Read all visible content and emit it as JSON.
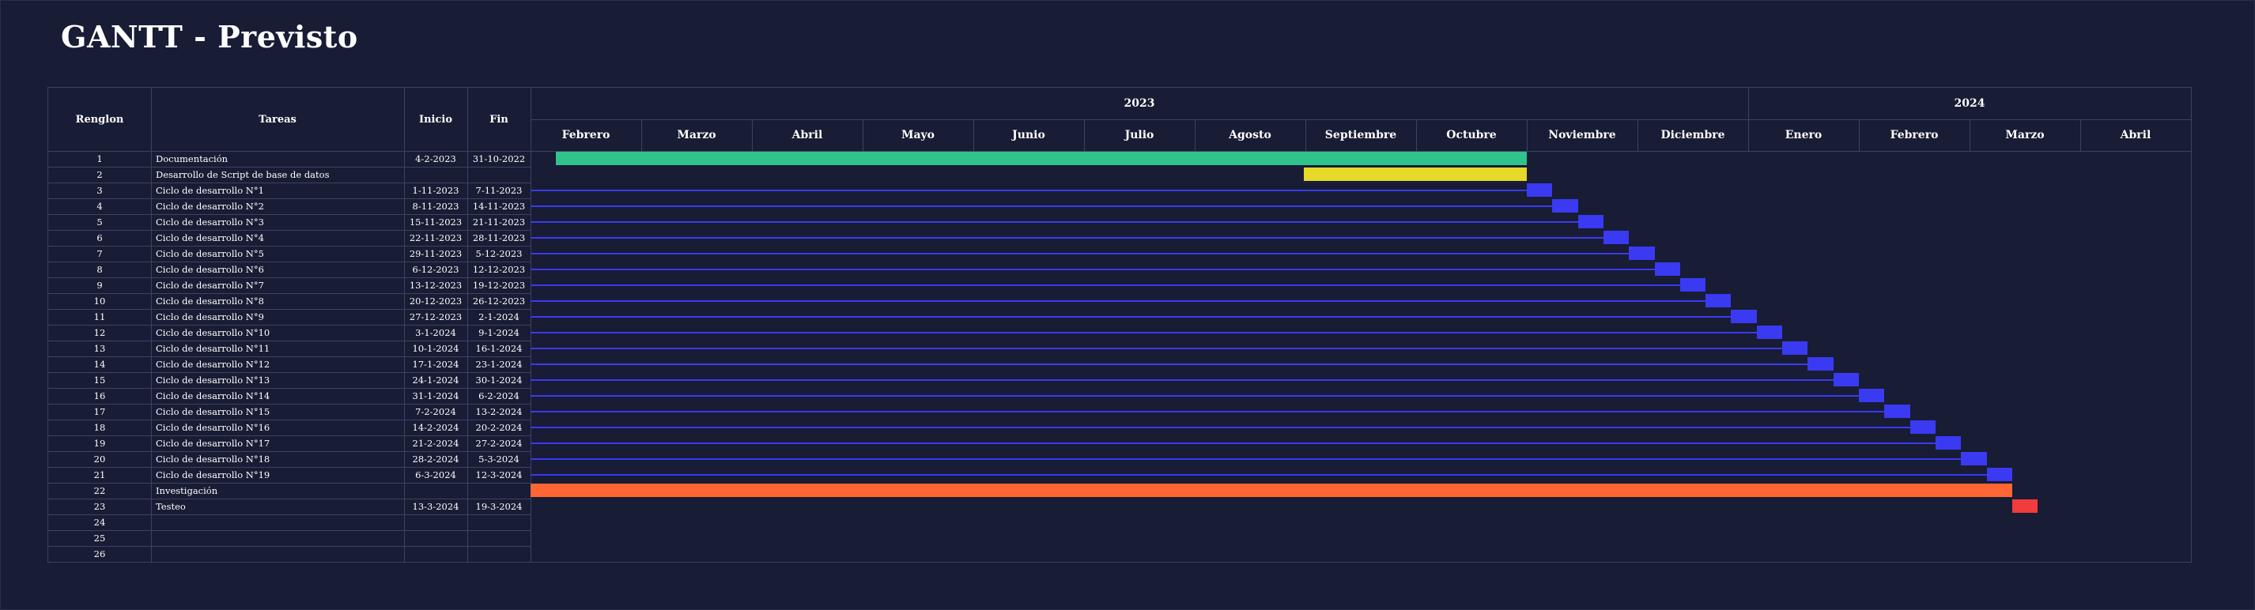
{
  "page": {
    "title": "GANTT - Previsto"
  },
  "table": {
    "headers": {
      "renglon": "Renglon",
      "tareas": "Tareas",
      "inicio": "Inicio",
      "fin": "Fin"
    },
    "rows": [
      {
        "n": "1",
        "task": "Documentación",
        "start": "4-2-2023",
        "end": "31-10-2022"
      },
      {
        "n": "2",
        "task": "Desarrollo de Script de base de datos",
        "start": "",
        "end": ""
      },
      {
        "n": "3",
        "task": "Ciclo de desarrollo N°1",
        "start": "1-11-2023",
        "end": "7-11-2023"
      },
      {
        "n": "4",
        "task": "Ciclo de desarrollo N°2",
        "start": "8-11-2023",
        "end": "14-11-2023"
      },
      {
        "n": "5",
        "task": "Ciclo de desarrollo N°3",
        "start": "15-11-2023",
        "end": "21-11-2023"
      },
      {
        "n": "6",
        "task": "Ciclo de desarrollo N°4",
        "start": "22-11-2023",
        "end": "28-11-2023"
      },
      {
        "n": "7",
        "task": "Ciclo de desarrollo N°5",
        "start": "29-11-2023",
        "end": "5-12-2023"
      },
      {
        "n": "8",
        "task": "Ciclo de desarrollo N°6",
        "start": "6-12-2023",
        "end": "12-12-2023"
      },
      {
        "n": "9",
        "task": "Ciclo de desarrollo N°7",
        "start": "13-12-2023",
        "end": "19-12-2023"
      },
      {
        "n": "10",
        "task": "Ciclo de desarrollo N°8",
        "start": "20-12-2023",
        "end": "26-12-2023"
      },
      {
        "n": "11",
        "task": "Ciclo de desarrollo N°9",
        "start": "27-12-2023",
        "end": "2-1-2024"
      },
      {
        "n": "12",
        "task": "Ciclo de desarrollo N°10",
        "start": "3-1-2024",
        "end": "9-1-2024"
      },
      {
        "n": "13",
        "task": "Ciclo de desarrollo N°11",
        "start": "10-1-2024",
        "end": "16-1-2024"
      },
      {
        "n": "14",
        "task": "Ciclo de desarrollo N°12",
        "start": "17-1-2024",
        "end": "23-1-2024"
      },
      {
        "n": "15",
        "task": "Ciclo de desarrollo N°13",
        "start": "24-1-2024",
        "end": "30-1-2024"
      },
      {
        "n": "16",
        "task": "Ciclo de desarrollo N°14",
        "start": "31-1-2024",
        "end": "6-2-2024"
      },
      {
        "n": "17",
        "task": "Ciclo de desarrollo N°15",
        "start": "7-2-2024",
        "end": "13-2-2024"
      },
      {
        "n": "18",
        "task": "Ciclo de desarrollo N°16",
        "start": "14-2-2024",
        "end": "20-2-2024"
      },
      {
        "n": "19",
        "task": "Ciclo de desarrollo N°17",
        "start": "21-2-2024",
        "end": "27-2-2024"
      },
      {
        "n": "20",
        "task": "Ciclo de desarrollo N°18",
        "start": "28-2-2024",
        "end": "5-3-2024"
      },
      {
        "n": "21",
        "task": "Ciclo de desarrollo N°19",
        "start": "6-3-2024",
        "end": "12-3-2024"
      },
      {
        "n": "22",
        "task": "Investigación",
        "start": "",
        "end": ""
      },
      {
        "n": "23",
        "task": "Testeo",
        "start": "13-3-2024",
        "end": "19-3-2024"
      },
      {
        "n": "24",
        "task": "",
        "start": "",
        "end": ""
      },
      {
        "n": "25",
        "task": "",
        "start": "",
        "end": ""
      },
      {
        "n": "26",
        "task": "",
        "start": "",
        "end": ""
      }
    ]
  },
  "timeline": {
    "years": [
      {
        "label": "2023",
        "months": 11
      },
      {
        "label": "2024",
        "months": 4
      }
    ],
    "months": [
      "Febrero",
      "Marzo",
      "Abril",
      "Mayo",
      "Junio",
      "Julio",
      "Agosto",
      "Septiembre",
      "Octubre",
      "Noviembre",
      "Diciembre",
      "Enero",
      "Febrero",
      "Marzo",
      "Abril"
    ],
    "range_start": "2023-02-01",
    "range_end": "2024-05-01"
  },
  "bars": [
    {
      "row": 1,
      "start": "2023-02-08",
      "end": "2023-11-01",
      "color": "#2ec48c"
    },
    {
      "row": 2,
      "start": "2023-09-01",
      "end": "2023-11-01",
      "color": "#e6d92a"
    },
    {
      "row": 3,
      "start": "2023-11-01",
      "end": "2023-11-08",
      "color": "#3a3af2",
      "connector": true
    },
    {
      "row": 4,
      "start": "2023-11-08",
      "end": "2023-11-15",
      "color": "#3a3af2",
      "connector": true
    },
    {
      "row": 5,
      "start": "2023-11-15",
      "end": "2023-11-22",
      "color": "#3a3af2",
      "connector": true
    },
    {
      "row": 6,
      "start": "2023-11-22",
      "end": "2023-11-29",
      "color": "#3a3af2",
      "connector": true
    },
    {
      "row": 7,
      "start": "2023-11-29",
      "end": "2023-12-06",
      "color": "#3a3af2",
      "connector": true
    },
    {
      "row": 8,
      "start": "2023-12-06",
      "end": "2023-12-13",
      "color": "#3a3af2",
      "connector": true
    },
    {
      "row": 9,
      "start": "2023-12-13",
      "end": "2023-12-20",
      "color": "#3a3af2",
      "connector": true
    },
    {
      "row": 10,
      "start": "2023-12-20",
      "end": "2023-12-27",
      "color": "#3a3af2",
      "connector": true
    },
    {
      "row": 11,
      "start": "2023-12-27",
      "end": "2024-01-03",
      "color": "#3a3af2",
      "connector": true
    },
    {
      "row": 12,
      "start": "2024-01-03",
      "end": "2024-01-10",
      "color": "#3a3af2",
      "connector": true
    },
    {
      "row": 13,
      "start": "2024-01-10",
      "end": "2024-01-17",
      "color": "#3a3af2",
      "connector": true
    },
    {
      "row": 14,
      "start": "2024-01-17",
      "end": "2024-01-24",
      "color": "#3a3af2",
      "connector": true
    },
    {
      "row": 15,
      "start": "2024-01-24",
      "end": "2024-01-31",
      "color": "#3a3af2",
      "connector": true
    },
    {
      "row": 16,
      "start": "2024-01-31",
      "end": "2024-02-07",
      "color": "#3a3af2",
      "connector": true
    },
    {
      "row": 17,
      "start": "2024-02-07",
      "end": "2024-02-14",
      "color": "#3a3af2",
      "connector": true
    },
    {
      "row": 18,
      "start": "2024-02-14",
      "end": "2024-02-21",
      "color": "#3a3af2",
      "connector": true
    },
    {
      "row": 19,
      "start": "2024-02-21",
      "end": "2024-02-28",
      "color": "#3a3af2",
      "connector": true
    },
    {
      "row": 20,
      "start": "2024-02-28",
      "end": "2024-03-06",
      "color": "#3a3af2",
      "connector": true
    },
    {
      "row": 21,
      "start": "2024-03-06",
      "end": "2024-03-13",
      "color": "#3a3af2",
      "connector": true
    },
    {
      "row": 22,
      "start": "2023-02-01",
      "end": "2024-03-13",
      "color": "#ff6633"
    },
    {
      "row": 23,
      "start": "2024-03-13",
      "end": "2024-03-20",
      "color": "#f23c3c"
    }
  ],
  "colors": {
    "background": "#181c34",
    "gridline": "#3c4262",
    "documentation": "#2ec48c",
    "script": "#e6d92a",
    "cycle": "#3a3af2",
    "investigation": "#ff6633",
    "testing": "#f23c3c"
  }
}
